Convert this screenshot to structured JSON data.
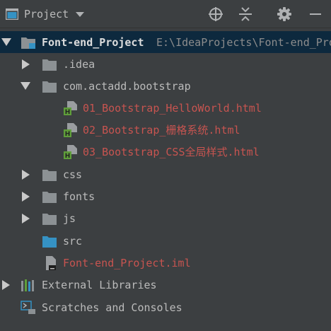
{
  "toolbar": {
    "title": "Project",
    "icons": [
      "project-window-icon",
      "locate-icon",
      "collapse-all-icon",
      "gear-icon",
      "hide-icon"
    ]
  },
  "tree": {
    "root": {
      "name": "Font-end_Project",
      "path": "E:\\IdeaProjects\\Font-end_Pro"
    },
    "idea": ".idea",
    "package": "com.actadd.bootstrap",
    "files": [
      "01_Bootstrap_HelloWorld.html",
      "02_Bootstrap_栅格系统.html",
      "03_Bootstrap_CSS全局样式.html"
    ],
    "css": "css",
    "fonts": "fonts",
    "js": "js",
    "src": "src",
    "iml": "Font-end_Project.iml",
    "external": "External Libraries",
    "scratches": "Scratches and Consoles"
  },
  "colors": {
    "background": "#3c3f41",
    "text": "#bbbbbb",
    "modified_red": "#c75450",
    "folder_grey": "#8c9194",
    "folder_blue": "#3592c4",
    "html_green": "#5f9e3a"
  }
}
